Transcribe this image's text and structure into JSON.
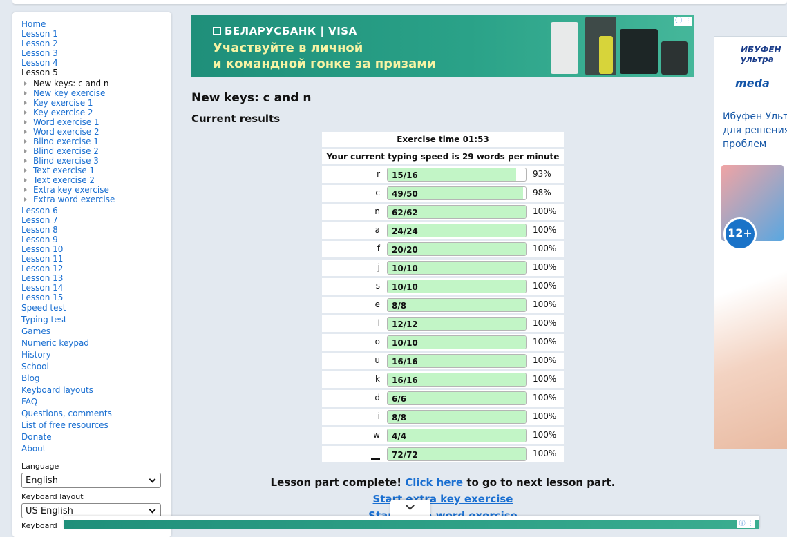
{
  "nav": {
    "home": "Home",
    "lessons_before": [
      "Lesson 1",
      "Lesson 2",
      "Lesson 3",
      "Lesson 4"
    ],
    "current_lesson": "Lesson 5",
    "sub_current": "New keys: c and n",
    "sub_items": [
      "New key exercise",
      "Key exercise 1",
      "Key exercise 2",
      "Word exercise 1",
      "Word exercise 2",
      "Blind exercise 1",
      "Blind exercise 2",
      "Blind exercise 3",
      "Text exercise 1",
      "Text exercise 2",
      "Extra key exercise",
      "Extra word exercise"
    ],
    "lessons_after": [
      "Lesson 6",
      "Lesson 7",
      "Lesson 8",
      "Lesson 9",
      "Lesson 10",
      "Lesson 11",
      "Lesson 12",
      "Lesson 13",
      "Lesson 14",
      "Lesson 15"
    ],
    "links": [
      "Speed test",
      "Typing test",
      "Games",
      "Numeric keypad",
      "History",
      "School",
      "Blog",
      "Keyboard layouts",
      "FAQ",
      "Questions, comments",
      "List of free resources",
      "Donate",
      "About"
    ]
  },
  "settings": {
    "language_label": "Language",
    "language_value": "English",
    "layout_label": "Keyboard layout",
    "layout_value": "US English",
    "keyboard_label": "Keyboard"
  },
  "ad_top": {
    "brand": "БЕЛАРУСБАНК | VISA",
    "line1": "Участвуйте в личной",
    "line2": "и командной гонке за призами",
    "info": "ⓘ ⋮"
  },
  "ad_right": {
    "logo1": "ИБУФЕН ультра",
    "logo2": "meda",
    "text": "Ибуфен Ультра для решения проблем",
    "age": "12+"
  },
  "main": {
    "title": "New keys: c and n",
    "subtitle": "Current results",
    "exercise_time": "Exercise time 01:53",
    "speed_text": "Your current typing speed is 29 words per minute"
  },
  "results": [
    {
      "key": "r",
      "value": "15/16",
      "pct": "93%",
      "fill": 0.93
    },
    {
      "key": "c",
      "value": "49/50",
      "pct": "98%",
      "fill": 0.98
    },
    {
      "key": "n",
      "value": "62/62",
      "pct": "100%",
      "fill": 1
    },
    {
      "key": "a",
      "value": "24/24",
      "pct": "100%",
      "fill": 1
    },
    {
      "key": "f",
      "value": "20/20",
      "pct": "100%",
      "fill": 1
    },
    {
      "key": "j",
      "value": "10/10",
      "pct": "100%",
      "fill": 1
    },
    {
      "key": "s",
      "value": "10/10",
      "pct": "100%",
      "fill": 1
    },
    {
      "key": "e",
      "value": "8/8",
      "pct": "100%",
      "fill": 1
    },
    {
      "key": "l",
      "value": "12/12",
      "pct": "100%",
      "fill": 1
    },
    {
      "key": "o",
      "value": "10/10",
      "pct": "100%",
      "fill": 1
    },
    {
      "key": "u",
      "value": "16/16",
      "pct": "100%",
      "fill": 1
    },
    {
      "key": "k",
      "value": "16/16",
      "pct": "100%",
      "fill": 1
    },
    {
      "key": "d",
      "value": "6/6",
      "pct": "100%",
      "fill": 1
    },
    {
      "key": "i",
      "value": "8/8",
      "pct": "100%",
      "fill": 1
    },
    {
      "key": "w",
      "value": "4/4",
      "pct": "100%",
      "fill": 1
    },
    {
      "key": "",
      "value": "72/72",
      "pct": "100%",
      "fill": 1
    }
  ],
  "footer": {
    "complete_prefix": "Lesson part complete!",
    "click_here": "Click here",
    "complete_suffix": "to go to next lesson part.",
    "extra_key": "Start extra key exercise",
    "extra_word": "Start extra word exercise"
  }
}
